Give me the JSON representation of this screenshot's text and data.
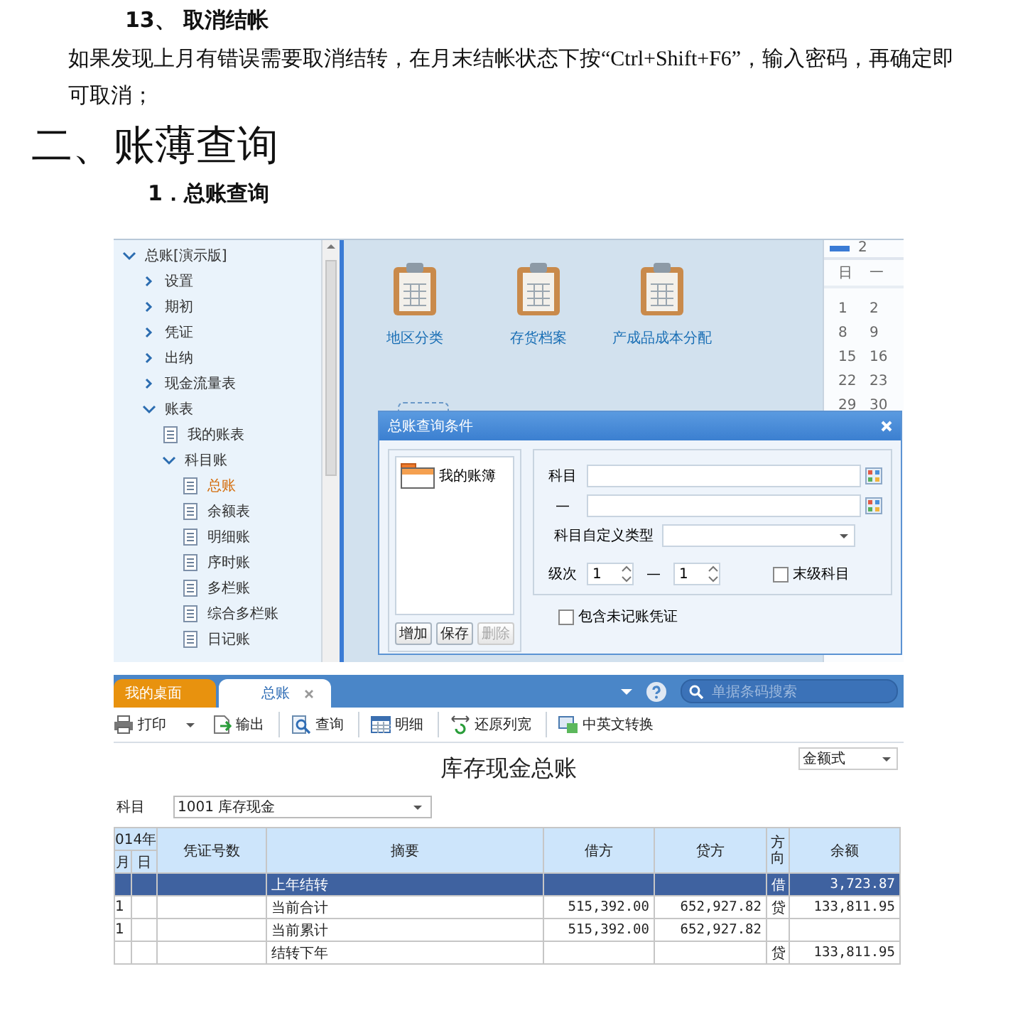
{
  "document": {
    "item_heading": "13、 取消结帐",
    "paragraph": "如果发现上月有错误需要取消结转，在月末结帐状态下按“Ctrl+Shift+F6”，输入密码，再确定即可取消；",
    "section_heading": "二、账薄查询",
    "subsection_heading": "1．总账查询"
  },
  "ledger_desktop": {
    "nav_tree": [
      {
        "kind": "folder",
        "label": "总账[演示版]",
        "expanded": true,
        "children": [
          {
            "kind": "folder",
            "label": "设置",
            "expanded": false
          },
          {
            "kind": "folder",
            "label": "期初",
            "expanded": false
          },
          {
            "kind": "folder",
            "label": "凭证",
            "expanded": false
          },
          {
            "kind": "folder",
            "label": "出纳",
            "expanded": false
          },
          {
            "kind": "folder",
            "label": "现金流量表",
            "expanded": false
          },
          {
            "kind": "folder",
            "label": "账表",
            "expanded": true,
            "children": [
              {
                "kind": "report",
                "label": "我的账表",
                "selected": false
              },
              {
                "kind": "folder",
                "label": "科目账",
                "expanded": true,
                "children": [
                  {
                    "kind": "report",
                    "label": "总账",
                    "selected": true
                  },
                  {
                    "kind": "report",
                    "label": "余额表",
                    "selected": false
                  },
                  {
                    "kind": "report",
                    "label": "明细账",
                    "selected": false
                  },
                  {
                    "kind": "report",
                    "label": "序时账",
                    "selected": false
                  },
                  {
                    "kind": "report",
                    "label": "多栏账",
                    "selected": false
                  },
                  {
                    "kind": "report",
                    "label": "综合多栏账",
                    "selected": false
                  },
                  {
                    "kind": "report",
                    "label": "日记账",
                    "selected": false
                  }
                ]
              }
            ]
          }
        ]
      }
    ],
    "desktop_icons": [
      {
        "label": "地区分类"
      },
      {
        "label": "存货档案"
      },
      {
        "label": "产成品成本分配"
      }
    ],
    "calendar": {
      "header": "2",
      "weekdays": [
        "日",
        "一"
      ],
      "days": [
        "1",
        "2",
        "8",
        "9",
        "15",
        "16",
        "22",
        "23",
        "29",
        "30"
      ]
    },
    "dialog": {
      "title": "总账查询条件",
      "saved_queries": [
        {
          "label": "我的账簿"
        }
      ],
      "buttons": [
        {
          "label": "增加",
          "disabled": false
        },
        {
          "label": "保存",
          "disabled": false
        },
        {
          "label": "删除",
          "disabled": true
        }
      ],
      "subject_label": "科目",
      "range_separator": "—",
      "custom_type_label": "科目自定义类型",
      "level_label": "级次",
      "level_from": "1",
      "level_separator": "—",
      "level_to": "1",
      "leaf_only": {
        "label": "末级科目",
        "checked": false
      },
      "include_unposted": {
        "label": "包含未记账凭证",
        "checked": false
      }
    }
  },
  "ledger_report": {
    "tabs": [
      {
        "label": "我的桌面",
        "selected": false,
        "closable": false
      },
      {
        "label": "总账",
        "selected": true,
        "closable": true
      }
    ],
    "search": {
      "placeholder": "单据条码搜索"
    },
    "toolbar": [
      {
        "kind": "print",
        "label": "打印",
        "dropdown": true
      },
      {
        "kind": "export",
        "label": "输出",
        "dropdown": false
      },
      {
        "kind": "query",
        "label": "查询",
        "dropdown": false
      },
      {
        "kind": "detail",
        "label": "明细",
        "dropdown": false
      },
      {
        "kind": "columns",
        "label": "还原列宽",
        "dropdown": false
      },
      {
        "kind": "translate",
        "label": "中英文转换",
        "dropdown": false
      }
    ],
    "format_select": "金额式",
    "title": "库存现金总账",
    "subject_label": "科目",
    "subject_value": "1001 库存现金",
    "columns": {
      "year": "014年",
      "month": "月",
      "day": "日",
      "voucher": "凭证号数",
      "summary": "摘要",
      "debit": "借方",
      "credit": "贷方",
      "direction": "方向",
      "balance": "余额"
    },
    "rows": [
      {
        "summary": "上年结转",
        "direction": "借",
        "balance": "3,723.87",
        "selected": true
      },
      {
        "month": "1",
        "summary": "当前合计",
        "debit": "515,392.00",
        "credit": "652,927.82",
        "direction": "贷",
        "balance": "133,811.95",
        "selected": false
      },
      {
        "month": "1",
        "summary": "当前累计",
        "debit": "515,392.00",
        "credit": "652,927.82",
        "selected": false
      },
      {
        "summary": "结转下年",
        "direction": "贷",
        "balance": "133,811.95",
        "selected": false
      }
    ]
  }
}
